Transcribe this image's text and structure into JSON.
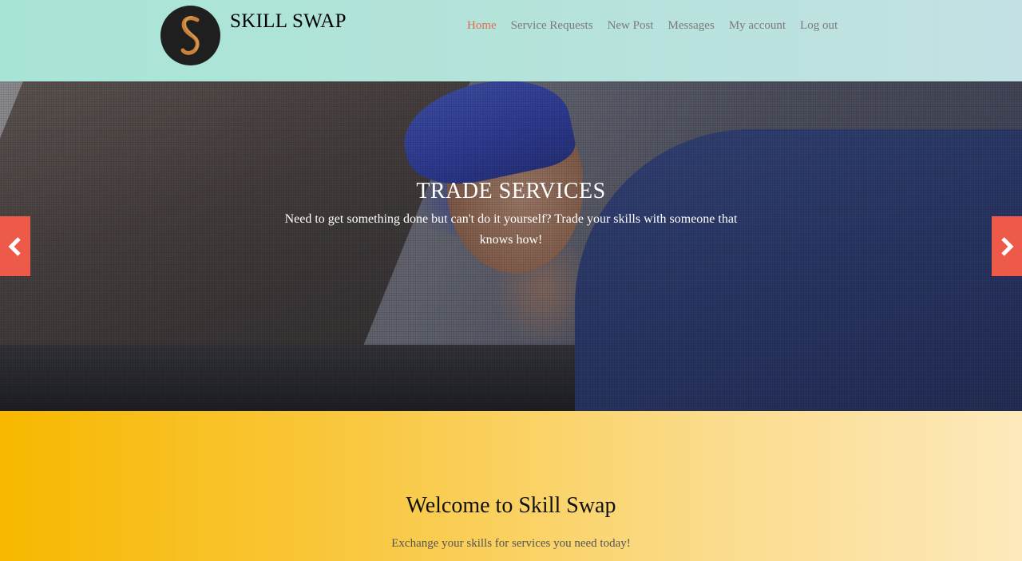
{
  "header": {
    "brand": "SKILL SWAP",
    "logo_icon": "s-monogram-logo",
    "nav": [
      {
        "label": "Home",
        "active": true
      },
      {
        "label": "Service Requests",
        "active": false
      },
      {
        "label": "New Post",
        "active": false
      },
      {
        "label": "Messages",
        "active": false
      },
      {
        "label": "My account",
        "active": false
      },
      {
        "label": "Log out",
        "active": false
      }
    ]
  },
  "hero": {
    "title": "TRADE SERVICES",
    "text": "Need to get something done but can't do it yourself? Trade your skills with someone that knows how!",
    "prev_icon": "chevron-left-icon",
    "next_icon": "chevron-right-icon"
  },
  "welcome": {
    "heading": "Welcome to Skill Swap",
    "subheading": "Exchange your skills for services you need today!"
  },
  "colors": {
    "accent": "#e26a52",
    "arrow": "#ee5a4a",
    "header_bg": "#b4e3da",
    "welcome_bg_start": "#f8b800",
    "welcome_bg_end": "#fde9bc"
  }
}
